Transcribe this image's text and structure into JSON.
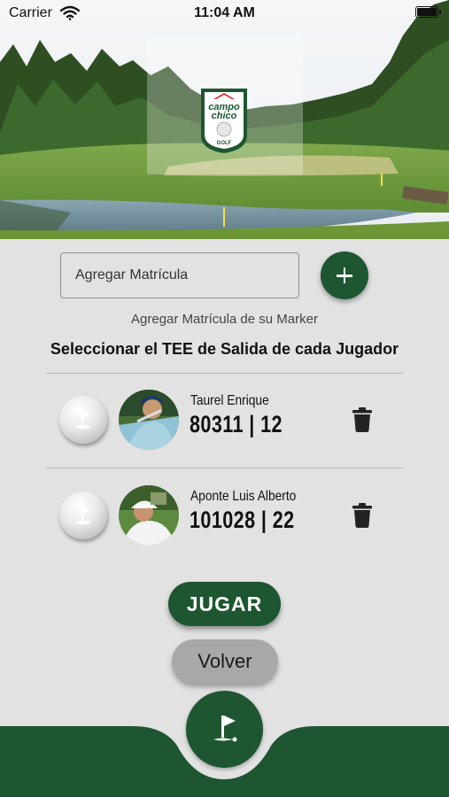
{
  "status_bar": {
    "carrier": "Carrier",
    "time": "11:04 AM"
  },
  "logo": {
    "line1": "campo",
    "line2": "chico",
    "line3": "GOLF"
  },
  "plate_input": {
    "placeholder": "Agregar Matrícula"
  },
  "helper_text": "Agregar Matrícula de su Marker",
  "section_title": "Seleccionar el TEE de Salida de cada Jugador",
  "players": [
    {
      "name": "Taurel Enrique",
      "stats": "80311 | 12"
    },
    {
      "name": "Aponte Luis Alberto",
      "stats": "101028 | 22"
    }
  ],
  "buttons": {
    "play": "JUGAR",
    "back": "Volver"
  },
  "colors": {
    "brand_green": "#1e5631",
    "background": "#e2e2e2",
    "back_button": "#a8a8a8"
  },
  "icons": {
    "add": "plus-icon",
    "tee": "golf-flag-icon",
    "delete": "trash-icon",
    "bottom": "golf-flag-icon"
  }
}
